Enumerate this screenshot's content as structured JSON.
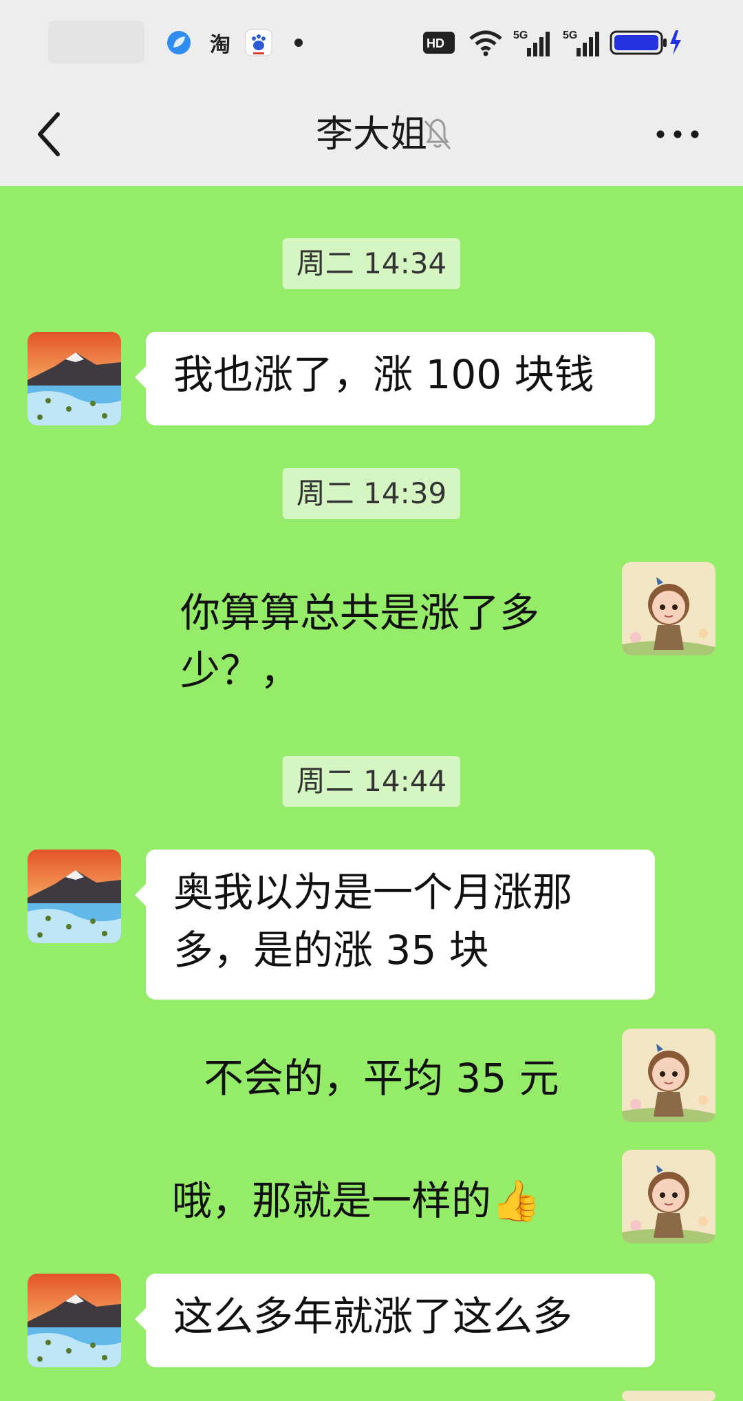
{
  "status_bar": {
    "icons": [
      "blue-leaf-app-icon",
      "taobao-icon",
      "baidu-icon",
      "notification-dot",
      "hd-icon",
      "wifi-icon",
      "5g-signal-icon",
      "5g-signal-icon",
      "battery-charging-icon"
    ],
    "taobao_label": "淘",
    "hd_label": "HD",
    "signal1_label": "5G",
    "signal2_label": "5G"
  },
  "nav": {
    "title": "李大姐"
  },
  "messages": [
    {
      "type": "time",
      "text": "周二 14:34"
    },
    {
      "type": "incoming",
      "text": "我也涨了，涨 100 块钱"
    },
    {
      "type": "time",
      "text": "周二 14:39"
    },
    {
      "type": "outgoing",
      "text": "你算算总共是涨了多少？，"
    },
    {
      "type": "time",
      "text": "周二 14:44"
    },
    {
      "type": "incoming",
      "text": "奥我以为是一个月涨那多，是的涨 35 块"
    },
    {
      "type": "outgoing",
      "text": "不会的，平均 35 元"
    },
    {
      "type": "outgoing",
      "text": "哦，那就是一样的👍"
    },
    {
      "type": "incoming",
      "text": "这么多年就涨了这么多"
    }
  ],
  "colors": {
    "chat_background": "#95ec69",
    "bar_background": "#ededed",
    "timestamp_background": "#d5f5c2",
    "bubble": "#ffffff"
  }
}
